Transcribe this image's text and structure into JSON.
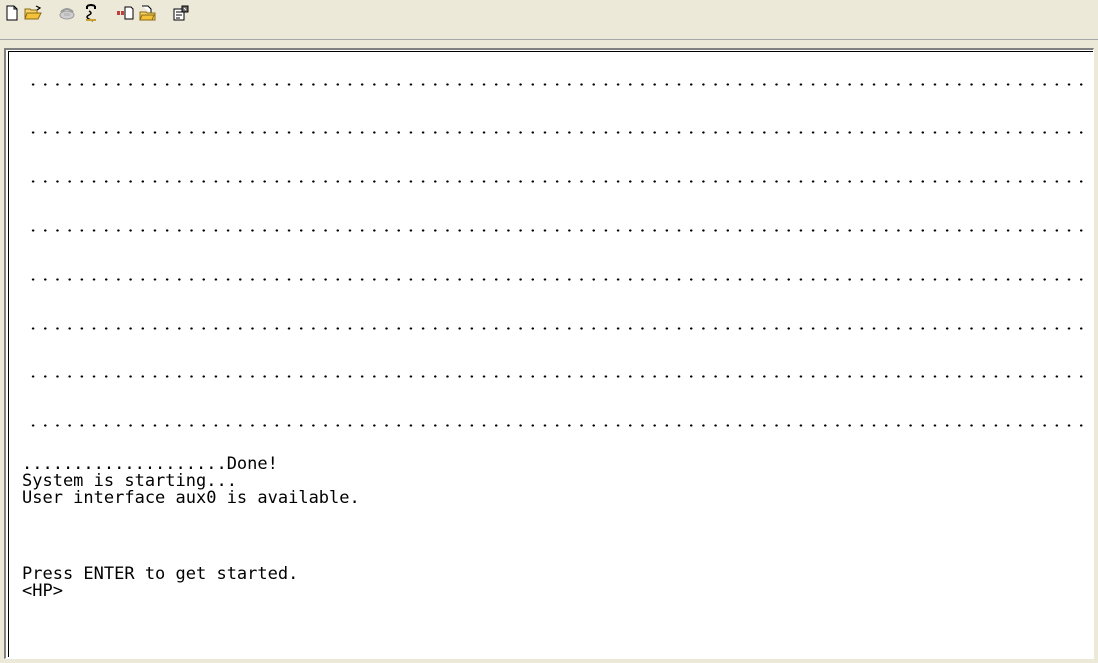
{
  "toolbar": {
    "buttons": [
      {
        "name": "new-icon",
        "tooltip": ""
      },
      {
        "name": "open-icon",
        "tooltip": ""
      },
      {
        "name": "disconnect-icon",
        "tooltip": ""
      },
      {
        "name": "dial-icon",
        "tooltip": ""
      },
      {
        "name": "send-icon",
        "tooltip": ""
      },
      {
        "name": "receive-icon",
        "tooltip": ""
      },
      {
        "name": "properties-icon",
        "tooltip": ""
      }
    ]
  },
  "terminal": {
    "dotted_rows": 8,
    "lines": {
      "done": "....................Done!",
      "starting": "System is starting...",
      "aux": "User interface aux0 is available.",
      "blank1": "",
      "blank2": "",
      "press": "Press ENTER to get started.",
      "prompt": "<HP>"
    }
  }
}
